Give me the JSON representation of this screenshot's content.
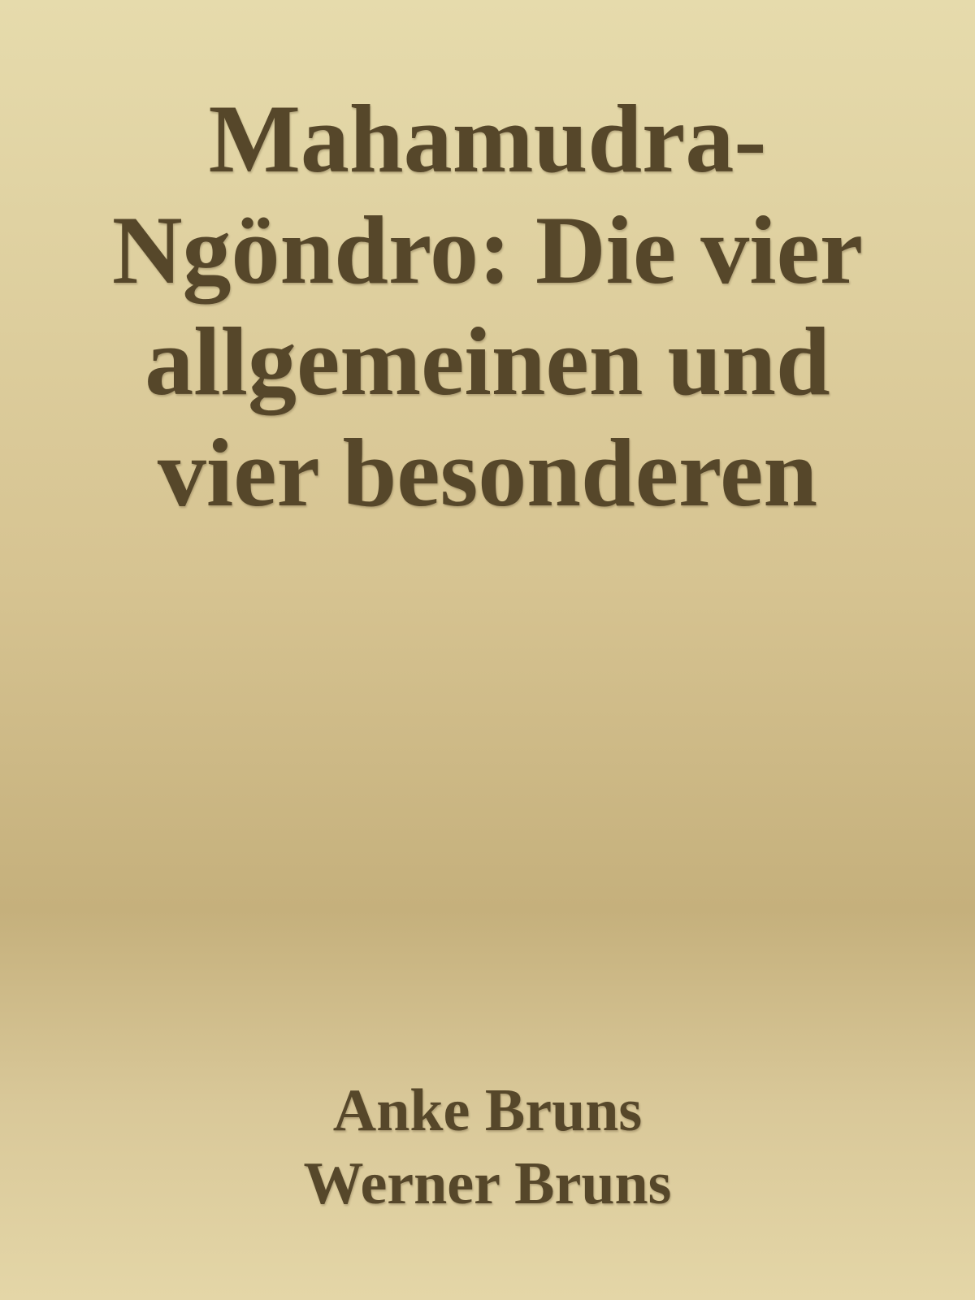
{
  "book": {
    "title": "Mahamudra-Ngöndro: Die vier allgemeinen und vier besonderen",
    "authors": [
      "Anke Bruns",
      "Werner Bruns"
    ]
  },
  "colors": {
    "text": "#56472a",
    "background_top": "#e6dbac",
    "background_middle": "#c5b07c",
    "background_bottom": "#e4d6a7"
  }
}
